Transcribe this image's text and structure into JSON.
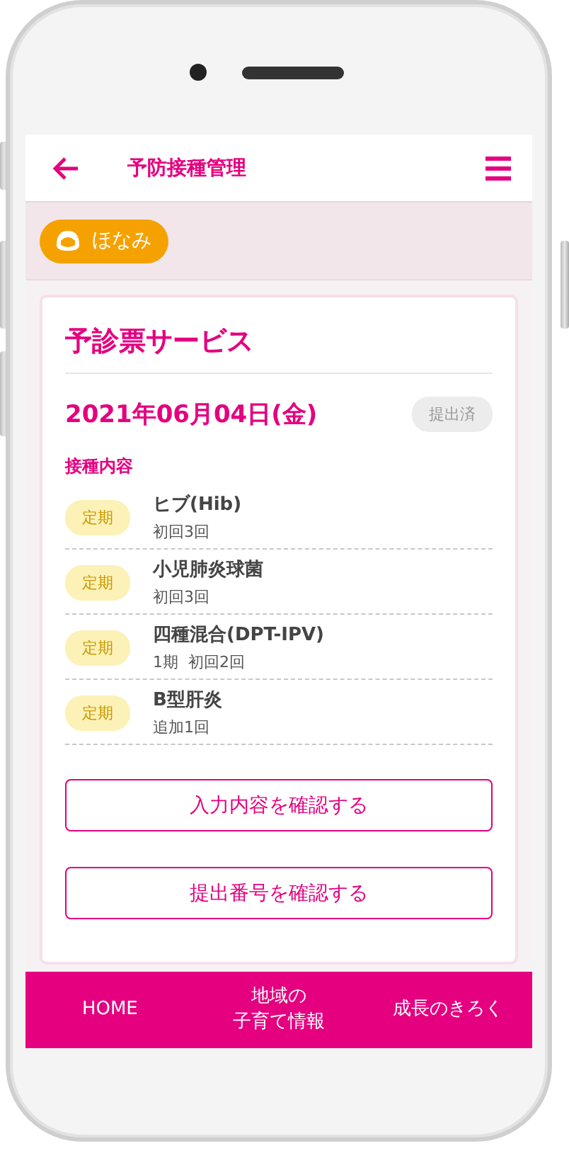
{
  "header": {
    "title": "予防接種管理"
  },
  "child": {
    "name": "ほなみ"
  },
  "card": {
    "title": "予診票サービス",
    "date": "2021年06月04日(金)",
    "status": "提出済",
    "section_label": "接種内容",
    "vaccines": [
      {
        "tag": "定期",
        "name": "ヒブ(Hib)",
        "dose": "初回3回"
      },
      {
        "tag": "定期",
        "name": "小児肺炎球菌",
        "dose": "初回3回"
      },
      {
        "tag": "定期",
        "name": "四種混合(DPT-IPV)",
        "dose": "1期  初回2回"
      },
      {
        "tag": "定期",
        "name": "B型肝炎",
        "dose": "追加1回"
      }
    ],
    "buttons": [
      "入力内容を確認する",
      "提出番号を確認する"
    ]
  },
  "bottom_nav": [
    {
      "label": "HOME"
    },
    {
      "label_lines": [
        "地域の",
        "子育て情報"
      ]
    },
    {
      "label": "成長のきろく"
    }
  ]
}
